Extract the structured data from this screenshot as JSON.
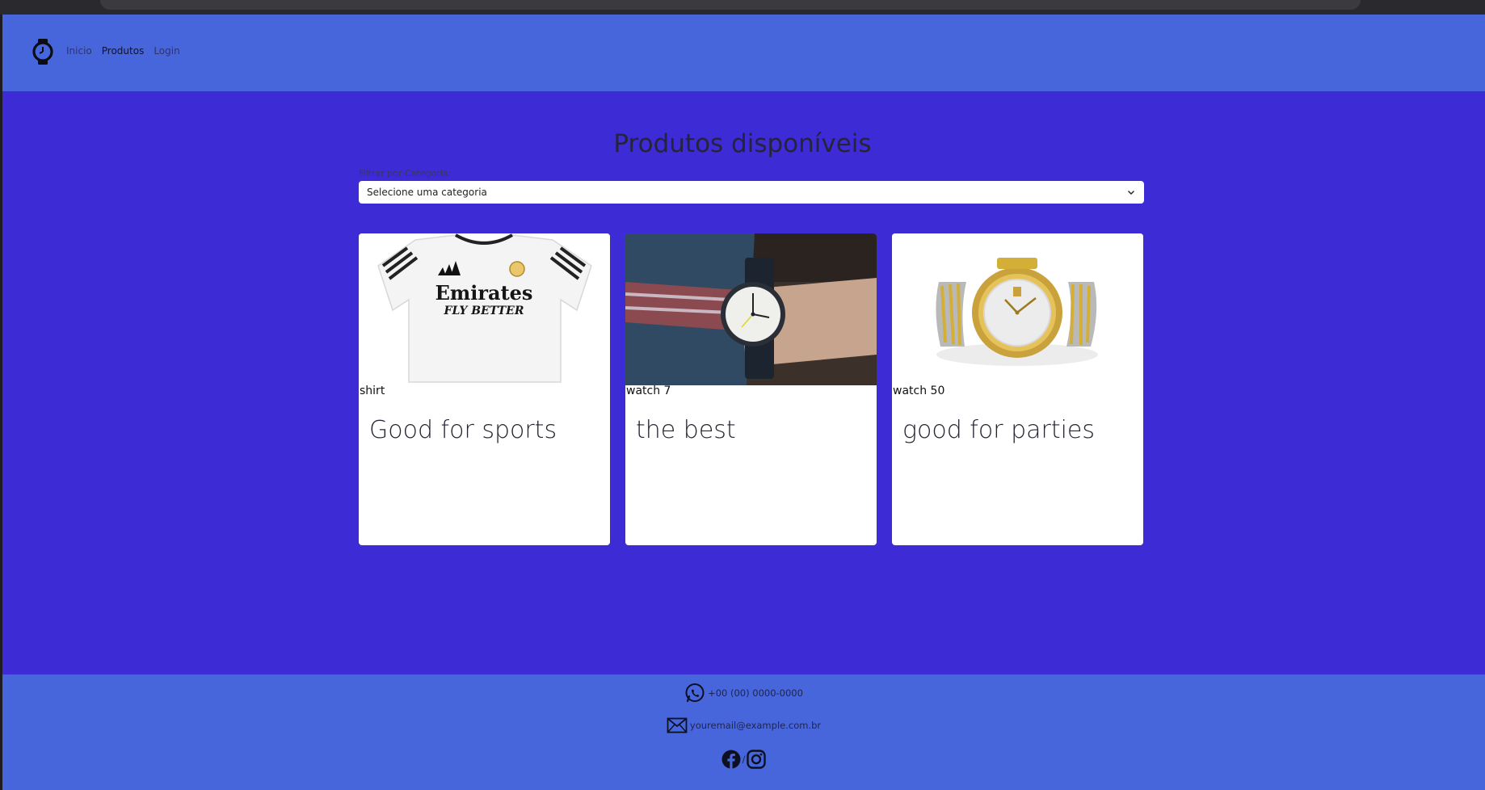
{
  "nav": {
    "items": [
      {
        "label": "Inicio"
      },
      {
        "label": "Produtos"
      },
      {
        "label": "Login"
      }
    ],
    "active": "Produtos",
    "logo_icon": "watch-icon"
  },
  "main": {
    "title": "Produtos disponíveis",
    "filter_label": "Filtrar por Categoria:",
    "filter_selected": "Selecione uma categoria"
  },
  "products": [
    {
      "name": "shirt",
      "description": "Good for sports",
      "image_icon": "shirt-image"
    },
    {
      "name": "watch 7",
      "description": "the best",
      "image_icon": "wrist-watch-image"
    },
    {
      "name": "watch 50",
      "description": "good for parties",
      "image_icon": "gold-watch-image"
    }
  ],
  "footer": {
    "phone": "+00 (00) 0000-0000",
    "email": "youremail@example.com.br",
    "social_separator": "/",
    "icons": [
      "whatsapp-icon",
      "mail-icon",
      "facebook-icon",
      "instagram-icon"
    ]
  },
  "colors": {
    "header_footer": "#4766dc",
    "body": "#3d2bd6",
    "card": "#ffffff"
  }
}
